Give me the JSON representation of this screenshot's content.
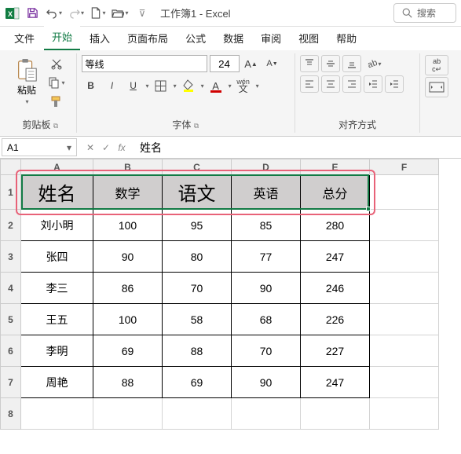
{
  "title": "工作簿1 - Excel",
  "search_placeholder": "搜索",
  "tabs": {
    "file": "文件",
    "home": "开始",
    "insert": "插入",
    "layout": "页面布局",
    "formulas": "公式",
    "data": "数据",
    "review": "审阅",
    "view": "视图",
    "help": "帮助"
  },
  "ribbon": {
    "clipboard_label": "剪贴板",
    "paste_label": "粘贴",
    "font_label": "字体",
    "font_name": "等线",
    "font_size": "24",
    "bold": "B",
    "italic": "I",
    "underline": "U",
    "wen": "wen\n文",
    "align_label": "对齐方式"
  },
  "name_box": "A1",
  "fx_label": "fx",
  "formula_value": "姓名",
  "cols": {
    "a": "A",
    "b": "B",
    "c": "C",
    "d": "D",
    "e": "E",
    "f": "F"
  },
  "rows": {
    "r1": "1",
    "r2": "2",
    "r3": "3",
    "r4": "4",
    "r5": "5",
    "r6": "6",
    "r7": "7",
    "r8": "8"
  },
  "header": {
    "name": "姓名",
    "math": "数学",
    "chinese": "语文",
    "english": "英语",
    "total": "总分"
  },
  "data": [
    {
      "name": "刘小明",
      "math": "100",
      "chinese": "95",
      "english": "85",
      "total": "280"
    },
    {
      "name": "张四",
      "math": "90",
      "chinese": "80",
      "english": "77",
      "total": "247"
    },
    {
      "name": "李三",
      "math": "86",
      "chinese": "70",
      "english": "90",
      "total": "246"
    },
    {
      "name": "王五",
      "math": "100",
      "chinese": "58",
      "english": "68",
      "total": "226"
    },
    {
      "name": "李明",
      "math": "69",
      "chinese": "88",
      "english": "70",
      "total": "227"
    },
    {
      "name": "周艳",
      "math": "88",
      "chinese": "69",
      "english": "90",
      "total": "247"
    }
  ],
  "chart_data": {
    "type": "table",
    "title": "",
    "columns": [
      "姓名",
      "数学",
      "语文",
      "英语",
      "总分"
    ],
    "rows": [
      [
        "刘小明",
        100,
        95,
        85,
        280
      ],
      [
        "张四",
        90,
        80,
        77,
        247
      ],
      [
        "李三",
        86,
        70,
        90,
        246
      ],
      [
        "王五",
        100,
        58,
        68,
        226
      ],
      [
        "李明",
        69,
        88,
        70,
        227
      ],
      [
        "周艳",
        88,
        69,
        90,
        247
      ]
    ]
  }
}
